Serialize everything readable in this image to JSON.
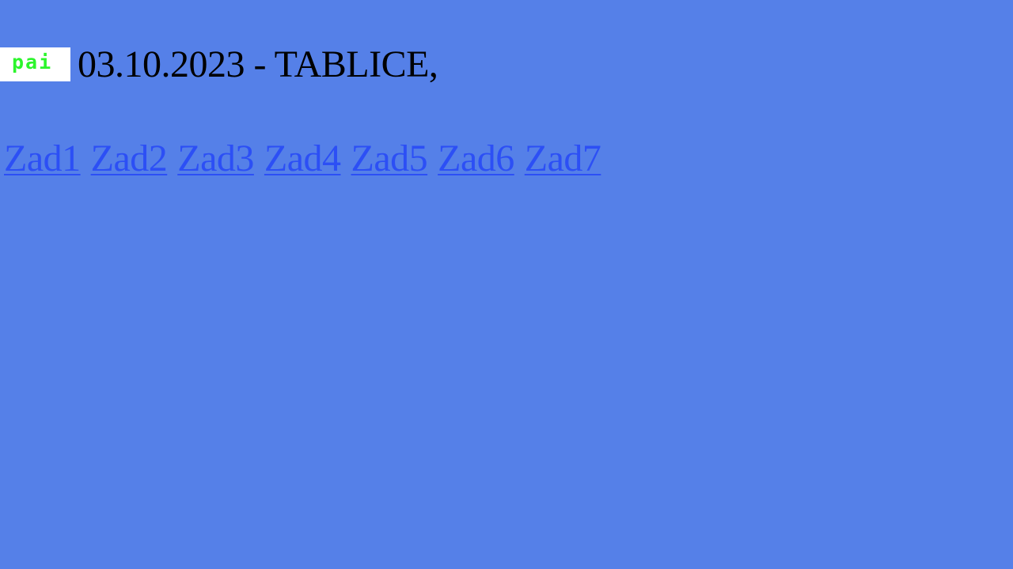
{
  "header": {
    "logo_text": "pai",
    "title": "03.10.2023 - TABLICE,"
  },
  "links": [
    {
      "label": "Zad1"
    },
    {
      "label": "Zad2"
    },
    {
      "label": "Zad3"
    },
    {
      "label": "Zad4"
    },
    {
      "label": "Zad5"
    },
    {
      "label": "Zad6"
    },
    {
      "label": "Zad7"
    }
  ],
  "colors": {
    "background": "#5580e8",
    "link": "#2c4ff5",
    "logo_text": "#2cf52c",
    "logo_background": "#ffffff",
    "title": "#000000"
  }
}
